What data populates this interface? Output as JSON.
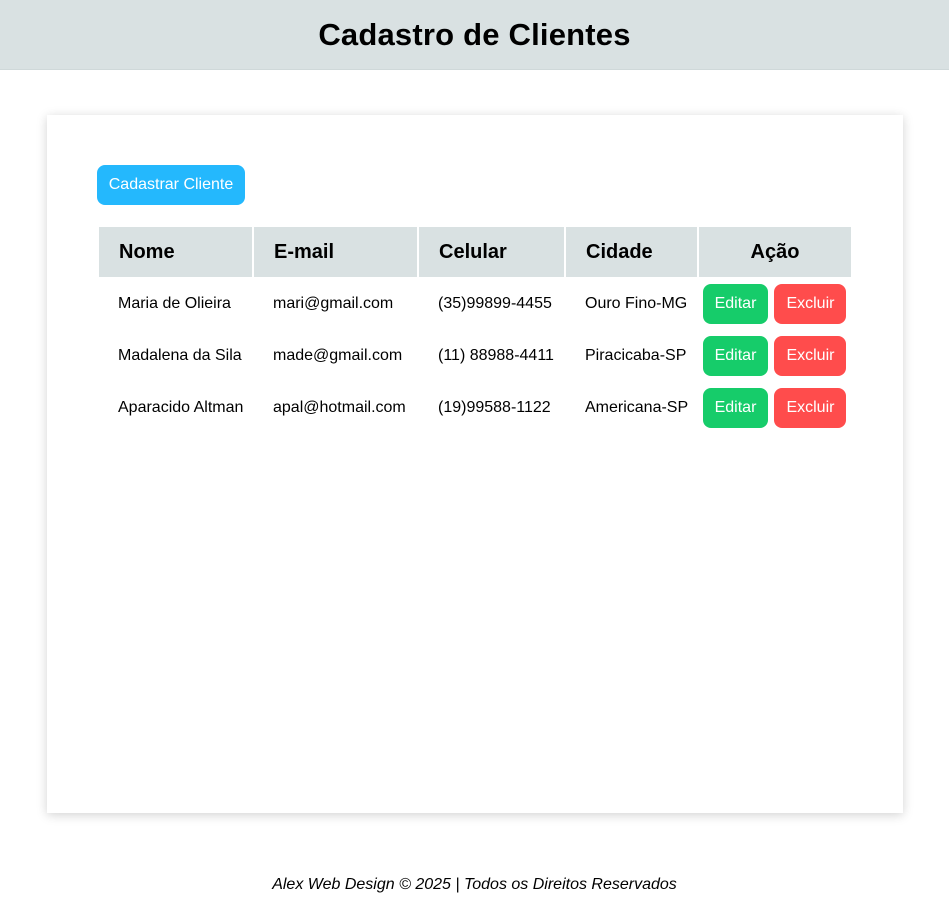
{
  "header": {
    "title": "Cadastro de Clientes"
  },
  "toolbar": {
    "add_label": "Cadastrar Cliente"
  },
  "table": {
    "columns": [
      "Nome",
      "E-mail",
      "Celular",
      "Cidade",
      "Ação"
    ],
    "rows": [
      {
        "nome": "Maria de Olieira",
        "email": "mari@gmail.com",
        "celular": "(35)99899-4455",
        "cidade": "Ouro Fino-MG",
        "edit_label": "Editar",
        "delete_label": "Excluir"
      },
      {
        "nome": "Madalena da Sila",
        "email": "made@gmail.com",
        "celular": "(11) 88988-4411",
        "cidade": "Piracicaba-SP",
        "edit_label": "Editar",
        "delete_label": "Excluir"
      },
      {
        "nome": "Aparacido Altman",
        "email": "apal@hotmail.com",
        "celular": "(19)99588-1122",
        "cidade": "Americana-SP",
        "edit_label": "Editar",
        "delete_label": "Excluir"
      }
    ]
  },
  "footer": {
    "text": "Alex Web Design © 2025 | Todos os Direitos Reservados"
  },
  "colors": {
    "header_bg": "#d9e1e2",
    "primary": "#24b8fd",
    "edit": "#16cc6a",
    "delete": "#ff4c4c"
  }
}
